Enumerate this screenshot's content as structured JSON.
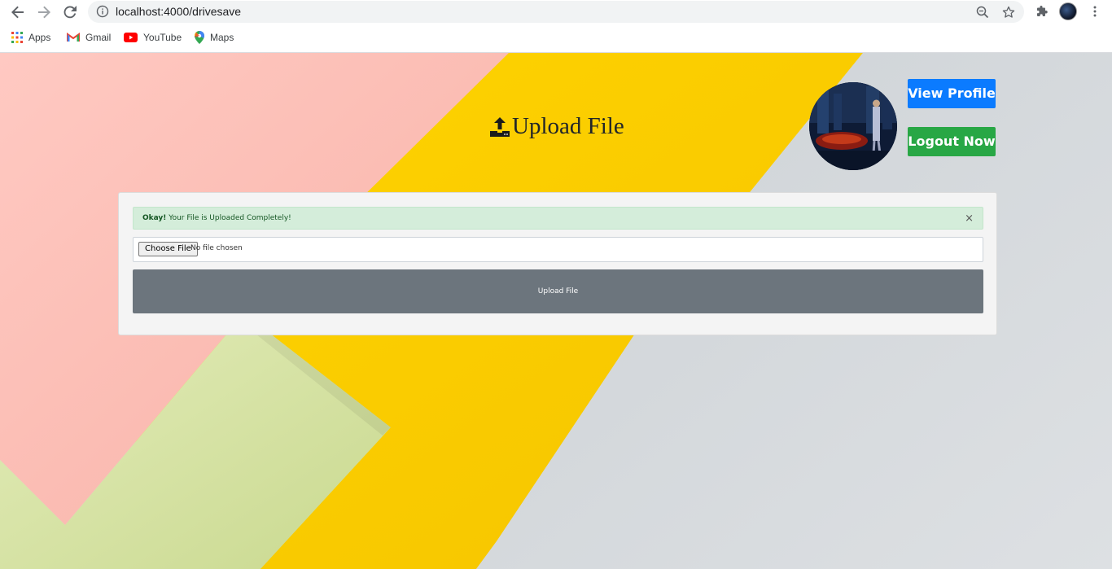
{
  "browser": {
    "url": "localhost:4000/drivesave",
    "bookmarks": [
      {
        "label": "Apps",
        "icon": "apps-grid-icon"
      },
      {
        "label": "Gmail",
        "icon": "gmail-icon"
      },
      {
        "label": "YouTube",
        "icon": "youtube-icon"
      },
      {
        "label": "Maps",
        "icon": "maps-pin-icon"
      }
    ]
  },
  "page": {
    "title": "Upload File",
    "view_profile_label": "View Profile",
    "logout_label": "Logout Now",
    "alert": {
      "strong": "Okay!",
      "message": " Your File is Uploaded Completely!",
      "close": "×"
    },
    "file_input": {
      "button_label": "Choose File",
      "status": "No file chosen"
    },
    "upload_button_label": "Upload File"
  },
  "colors": {
    "primary": "#0b7bff",
    "success": "#28a745",
    "secondary": "#6c757d",
    "alert_bg": "#d4edda",
    "alert_text": "#155724"
  }
}
